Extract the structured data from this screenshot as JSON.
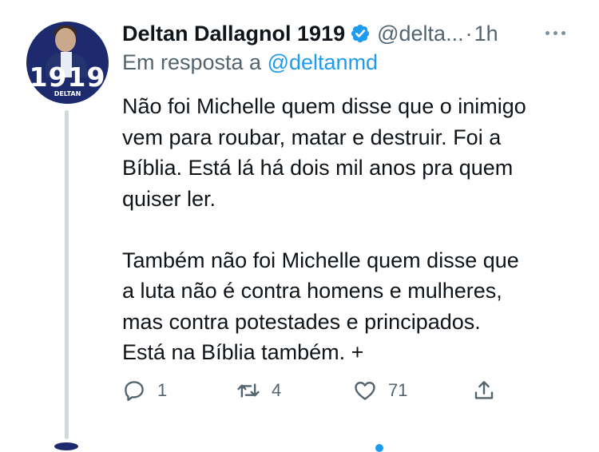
{
  "tweet": {
    "avatar": {
      "number": "1919",
      "brand": "DELTAN",
      "icon": "profile-photo"
    },
    "author": {
      "display_name": "Deltan Dallagnol 1919",
      "handle": "@delta...",
      "verified_icon": "verified-badge-icon"
    },
    "separator": "·",
    "time": "1h",
    "more_icon": "more-horizontal-icon",
    "reply_to": {
      "prefix": "Em resposta a",
      "mention": "@deltanmd"
    },
    "paragraphs": [
      [
        "Não foi Michelle quem disse que o inimigo",
        "vem para roubar, matar e destruir. Foi a",
        "Bíblia. Está lá há dois mil anos pra quem",
        "quiser ler."
      ],
      [
        "Também não foi Michelle quem disse que",
        "a luta não é contra homens e mulheres,",
        "mas contra potestades e principados.",
        "Está na Bíblia também. +"
      ]
    ],
    "actions": {
      "reply": {
        "icon": "reply-icon",
        "count": "1"
      },
      "retweet": {
        "icon": "retweet-icon",
        "count": "4"
      },
      "like": {
        "icon": "heart-icon",
        "count": "71"
      },
      "share": {
        "icon": "share-icon"
      }
    },
    "colors": {
      "accent": "#1d9bf0",
      "text": "#0f1419",
      "secondary": "#536471",
      "thread_line": "#cfd9de"
    }
  }
}
